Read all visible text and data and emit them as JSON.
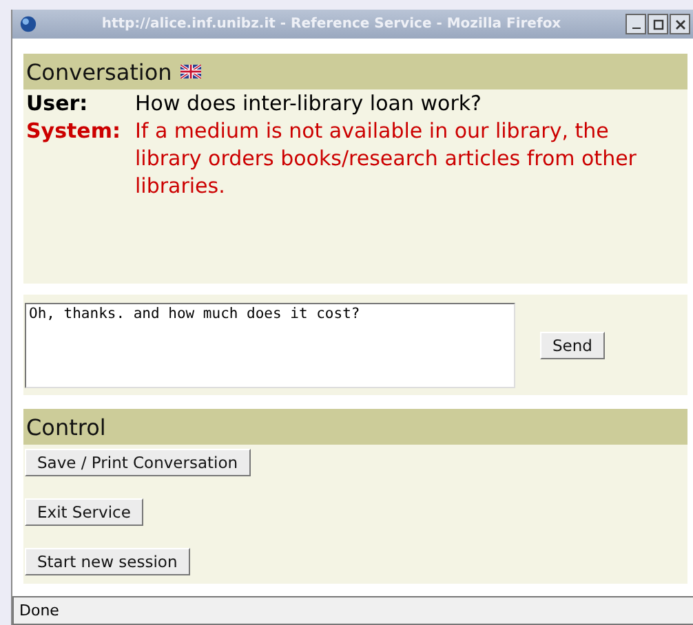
{
  "window": {
    "title": "http://alice.inf.unibz.it - Reference Service - Mozilla Firefox"
  },
  "conversation": {
    "title": "Conversation",
    "messages": [
      {
        "kind": "user",
        "speaker": "User:",
        "text": "How does inter-library loan work?"
      },
      {
        "kind": "system",
        "speaker": "System:",
        "text": "If a medium is not available in our library, the library orders books/research articles from other libraries."
      }
    ]
  },
  "input": {
    "value": "Oh, thanks. and how much does it cost?",
    "button": "Send"
  },
  "control": {
    "title": "Control",
    "buttons": [
      "Save / Print Conversation",
      "Exit Service",
      "Start new session"
    ]
  },
  "status_bar": "Done"
}
